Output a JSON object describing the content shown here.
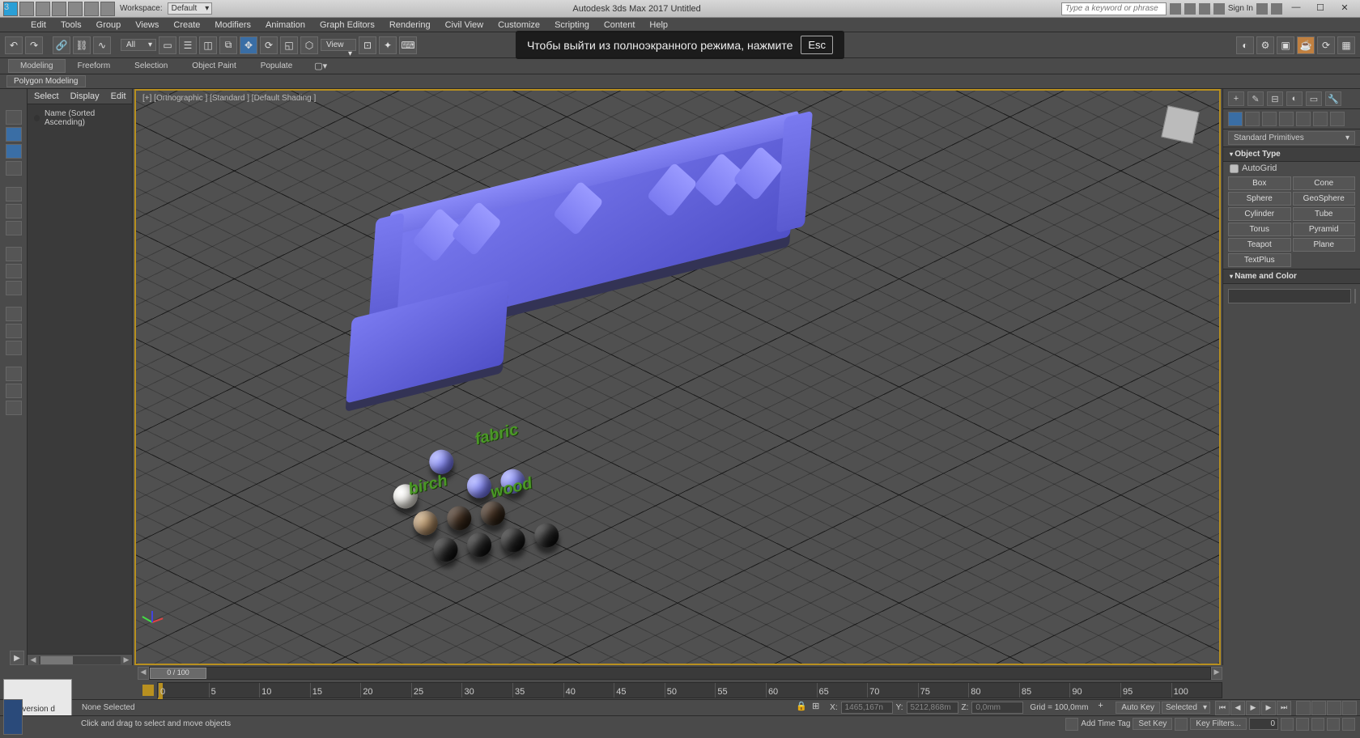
{
  "titlebar": {
    "workspace_label": "Workspace:",
    "workspace_value": "Default",
    "app_title": "Autodesk 3ds Max 2017    Untitled",
    "search_placeholder": "Type a keyword or phrase",
    "signin": "Sign In"
  },
  "menu": [
    "Edit",
    "Tools",
    "Group",
    "Views",
    "Create",
    "Modifiers",
    "Animation",
    "Graph Editors",
    "Rendering",
    "Civil View",
    "Customize",
    "Scripting",
    "Content",
    "Help"
  ],
  "toolbar": {
    "sel_filter": "All",
    "ref_coord": "View",
    "overlay_text": "Чтобы выйти из полноэкранного режима, нажмите",
    "overlay_key": "Esc"
  },
  "ribbon": {
    "tabs": [
      "Modeling",
      "Freeform",
      "Selection",
      "Object Paint",
      "Populate"
    ],
    "active": 0,
    "panel": "Polygon Modeling"
  },
  "scene_explorer": {
    "tabs": [
      "Select",
      "Display",
      "Edit"
    ],
    "header": "Name (Sorted Ascending)"
  },
  "viewport": {
    "label": "[+] [Orthographic ] [Standard ] [Default Shading ]",
    "text_labels": {
      "fabric": "fabric",
      "birch": "birch",
      "wood": "wood"
    }
  },
  "command_panel": {
    "dropdown": "Standard Primitives",
    "rollout_objtype": "Object Type",
    "autogrid": "AutoGrid",
    "buttons": [
      "Box",
      "Cone",
      "Sphere",
      "GeoSphere",
      "Cylinder",
      "Tube",
      "Torus",
      "Pyramid",
      "Teapot",
      "Plane",
      "TextPlus"
    ],
    "rollout_name": "Name and Color",
    "name_value": ""
  },
  "timeline": {
    "slider_label": "0 / 100",
    "ticks": [
      0,
      5,
      10,
      15,
      20,
      25,
      30,
      35,
      40,
      45,
      50,
      55,
      60,
      65,
      70,
      75,
      80,
      85,
      90,
      95,
      100
    ]
  },
  "status": {
    "macro": "Conversion  d",
    "selection": "None Selected",
    "prompt": "Click and drag to select and move objects",
    "x_label": "X:",
    "x_val": "1465,167n",
    "y_label": "Y:",
    "y_val": "5212,868m",
    "z_label": "Z:",
    "z_val": "0,0mm",
    "grid": "Grid = 100,0mm",
    "autokey": "Auto Key",
    "selected": "Selected",
    "setkey": "Set Key",
    "keyfilters": "Key Filters...",
    "addtag": "Add Time Tag",
    "frame_spin": "0"
  }
}
